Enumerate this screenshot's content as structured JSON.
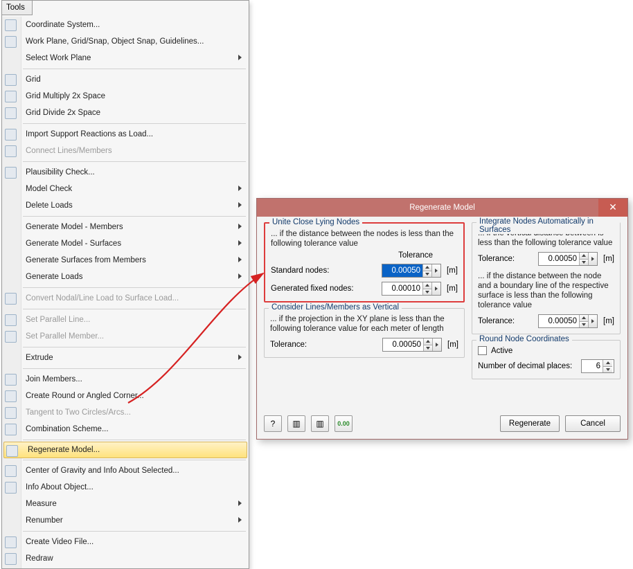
{
  "menu": {
    "title": "Tools",
    "items": [
      {
        "label": "Coordinate System...",
        "icon": true
      },
      {
        "label": "Work Plane, Grid/Snap, Object Snap, Guidelines...",
        "icon": true
      },
      {
        "label": "Select Work Plane",
        "sub": true
      },
      {
        "sep": true
      },
      {
        "label": "Grid",
        "icon": true
      },
      {
        "label": "Grid Multiply 2x Space",
        "icon": true
      },
      {
        "label": "Grid Divide 2x Space",
        "icon": true
      },
      {
        "sep": true
      },
      {
        "label": "Import Support Reactions as Load...",
        "icon": true
      },
      {
        "label": "Connect Lines/Members",
        "icon": true,
        "disabled": true
      },
      {
        "sep": true
      },
      {
        "label": "Plausibility Check...",
        "icon": true
      },
      {
        "label": "Model Check",
        "sub": true
      },
      {
        "label": "Delete Loads",
        "sub": true
      },
      {
        "sep": true
      },
      {
        "label": "Generate Model - Members",
        "sub": true
      },
      {
        "label": "Generate Model - Surfaces",
        "sub": true
      },
      {
        "label": "Generate Surfaces from Members",
        "sub": true
      },
      {
        "label": "Generate Loads",
        "sub": true
      },
      {
        "sep": true
      },
      {
        "label": "Convert Nodal/Line Load to Surface Load...",
        "icon": true,
        "disabled": true
      },
      {
        "sep": true
      },
      {
        "label": "Set Parallel Line...",
        "icon": true,
        "disabled": true
      },
      {
        "label": "Set Parallel Member...",
        "icon": true,
        "disabled": true
      },
      {
        "sep": true
      },
      {
        "label": "Extrude",
        "sub": true
      },
      {
        "sep": true
      },
      {
        "label": "Join Members...",
        "icon": true
      },
      {
        "label": "Create Round or Angled Corner...",
        "icon": true
      },
      {
        "label": "Tangent to Two Circles/Arcs...",
        "icon": true,
        "disabled": true
      },
      {
        "label": "Combination Scheme...",
        "icon": true
      },
      {
        "sep": true
      },
      {
        "label": "Regenerate Model...",
        "icon": true,
        "hl": true
      },
      {
        "sep": true
      },
      {
        "label": "Center of Gravity and Info About Selected...",
        "icon": true
      },
      {
        "label": "Info About Object...",
        "icon": true
      },
      {
        "label": "Measure",
        "sub": true
      },
      {
        "label": "Renumber",
        "sub": true
      },
      {
        "sep": true
      },
      {
        "label": "Create Video File...",
        "icon": true
      },
      {
        "label": "Redraw",
        "icon": true
      }
    ]
  },
  "dialog": {
    "title": "Regenerate Model",
    "unite": {
      "legend": "Unite Close Lying Nodes",
      "desc": "... if the distance between the nodes is less than the following tolerance value",
      "tol_header": "Tolerance",
      "row1_label": "Standard nodes:",
      "row1_value": "0.00050",
      "row2_label": "Generated fixed nodes:",
      "row2_value": "0.00010",
      "unit": "[m]"
    },
    "consider": {
      "legend": "Consider Lines/Members as Vertical",
      "desc": "... if the projection in the XY plane is less than the following tolerance value for each meter of length",
      "row_label": "Tolerance:",
      "row_value": "0.00050",
      "unit": "[m]"
    },
    "integrate": {
      "legend": "Integrate Nodes Automatically in Surfaces",
      "desc1": "... if the vertical distance between is less than the following tolerance value",
      "row1_label": "Tolerance:",
      "row1_value": "0.00050",
      "desc2": "... if the distance between the node and a boundary line of the respective surface is less than the following tolerance value",
      "row2_label": "Tolerance:",
      "row2_value": "0.00050",
      "unit": "[m]"
    },
    "round": {
      "legend": "Round Node Coordinates",
      "check_label": "Active",
      "row_label": "Number of decimal places:",
      "row_value": "6"
    },
    "buttons": {
      "regen": "Regenerate",
      "cancel": "Cancel"
    },
    "toolbar_icons": [
      "help-icon",
      "columns-icon",
      "columns2-icon",
      "zero-icon"
    ]
  }
}
